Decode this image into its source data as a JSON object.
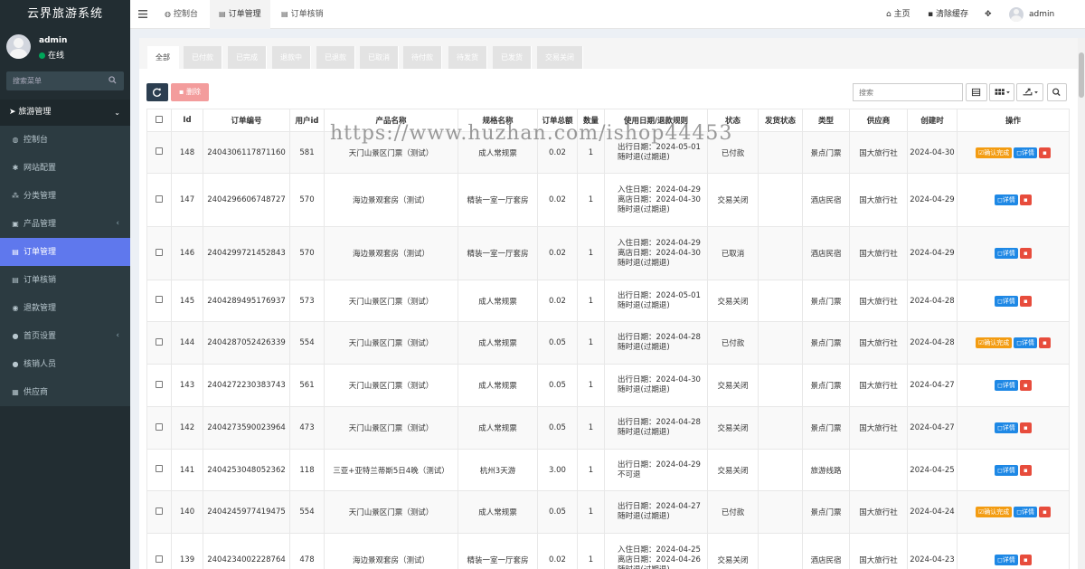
{
  "app": {
    "title": "云界旅游系统"
  },
  "user": {
    "name": "admin",
    "status": "在线"
  },
  "sidebar": {
    "search_placeholder": "搜索菜单",
    "section": "旅游管理",
    "items": [
      {
        "label": "控制台",
        "icon": "dashboard-icon",
        "glyph": "◍",
        "arrow": ""
      },
      {
        "label": "网站配置",
        "icon": "gear-icon",
        "glyph": "✱",
        "arrow": ""
      },
      {
        "label": "分类管理",
        "icon": "sitemap-icon",
        "glyph": "⁂",
        "arrow": ""
      },
      {
        "label": "产品管理",
        "icon": "box-icon",
        "glyph": "▣",
        "arrow": "‹"
      },
      {
        "label": "订单管理",
        "icon": "file-icon",
        "glyph": "▤",
        "arrow": "",
        "active": true
      },
      {
        "label": "订单核销",
        "icon": "file-check-icon",
        "glyph": "▤",
        "arrow": ""
      },
      {
        "label": "退款管理",
        "icon": "eye-icon",
        "glyph": "◉",
        "arrow": ""
      },
      {
        "label": "首页设置",
        "icon": "users-icon",
        "glyph": "●",
        "arrow": "‹"
      },
      {
        "label": "核销人员",
        "icon": "user-icon",
        "glyph": "●",
        "arrow": ""
      },
      {
        "label": "供应商",
        "icon": "id-card-icon",
        "glyph": "▦",
        "arrow": ""
      }
    ]
  },
  "topbar": {
    "tabs": [
      {
        "label": "控制台",
        "glyph": "◍"
      },
      {
        "label": "订单管理",
        "glyph": "▤"
      },
      {
        "label": "订单核销",
        "glyph": "▤"
      }
    ],
    "home_label": "主页",
    "clear_cache_label": "清除缓存",
    "user_label": "admin"
  },
  "filters": [
    "全部",
    "已付款",
    "已完成",
    "退款中",
    "已退款",
    "已取消",
    "待付款",
    "待发货",
    "已发货",
    "交易关闭"
  ],
  "toolbar": {
    "delete_label": "删除",
    "search_placeholder": "搜索"
  },
  "table": {
    "headers": [
      "Id",
      "订单编号",
      "用户id",
      "产品名称",
      "规格名称",
      "订单总额",
      "数量",
      "使用日期/退款规则",
      "状态",
      "发货状态",
      "类型",
      "供应商",
      "创建时",
      "操作"
    ],
    "confirm_label": "确认完成",
    "detail_label": "详情",
    "rows": [
      {
        "id": "148",
        "order_no": "2404306117871160",
        "user_id": "581",
        "product": "天门山景区门票（测试）",
        "spec": "成人常规票",
        "total": "0.02",
        "qty": "1",
        "rule": [
          "出行日期：2024-05-01",
          "随时退(过期退)"
        ],
        "status": "已付款",
        "ship": "",
        "type": "景点门票",
        "supplier": "国大旅行社",
        "created": "2024-04-30",
        "confirm": true
      },
      {
        "id": "147",
        "order_no": "2404296606748727",
        "user_id": "570",
        "product": "海边景观套房（测试）",
        "spec": "精装一室一厅套房",
        "total": "0.02",
        "qty": "1",
        "rule": [
          "入住日期：2024-04-29",
          "离店日期：2024-04-30",
          "随时退(过期退)"
        ],
        "status": "交易关闭",
        "ship": "",
        "type": "酒店民宿",
        "supplier": "国大旅行社",
        "created": "2024-04-29",
        "confirm": false
      },
      {
        "id": "146",
        "order_no": "2404299721452843",
        "user_id": "570",
        "product": "海边景观套房（测试）",
        "spec": "精装一室一厅套房",
        "total": "0.02",
        "qty": "1",
        "rule": [
          "入住日期：2024-04-29",
          "离店日期：2024-04-30",
          "随时退(过期退)"
        ],
        "status": "已取消",
        "ship": "",
        "type": "酒店民宿",
        "supplier": "国大旅行社",
        "created": "2024-04-29",
        "confirm": false
      },
      {
        "id": "145",
        "order_no": "2404289495176937",
        "user_id": "573",
        "product": "天门山景区门票（测试）",
        "spec": "成人常规票",
        "total": "0.02",
        "qty": "1",
        "rule": [
          "出行日期：2024-05-01",
          "随时退(过期退)"
        ],
        "status": "交易关闭",
        "ship": "",
        "type": "景点门票",
        "supplier": "国大旅行社",
        "created": "2024-04-28",
        "confirm": false
      },
      {
        "id": "144",
        "order_no": "2404287052426339",
        "user_id": "554",
        "product": "天门山景区门票（测试）",
        "spec": "成人常规票",
        "total": "0.05",
        "qty": "1",
        "rule": [
          "出行日期：2024-04-28",
          "随时退(过期退)"
        ],
        "status": "已付款",
        "ship": "",
        "type": "景点门票",
        "supplier": "国大旅行社",
        "created": "2024-04-28",
        "confirm": true
      },
      {
        "id": "143",
        "order_no": "2404272230383743",
        "user_id": "561",
        "product": "天门山景区门票（测试）",
        "spec": "成人常规票",
        "total": "0.05",
        "qty": "1",
        "rule": [
          "出行日期：2024-04-30",
          "随时退(过期退)"
        ],
        "status": "交易关闭",
        "ship": "",
        "type": "景点门票",
        "supplier": "国大旅行社",
        "created": "2024-04-27",
        "confirm": false
      },
      {
        "id": "142",
        "order_no": "2404273590023964",
        "user_id": "473",
        "product": "天门山景区门票（测试）",
        "spec": "成人常规票",
        "total": "0.05",
        "qty": "1",
        "rule": [
          "出行日期：2024-04-28",
          "随时退(过期退)"
        ],
        "status": "交易关闭",
        "ship": "",
        "type": "景点门票",
        "supplier": "国大旅行社",
        "created": "2024-04-27",
        "confirm": false
      },
      {
        "id": "141",
        "order_no": "2404253048052362",
        "user_id": "118",
        "product": "三亚+亚特兰蒂斯5日4晚（测试）",
        "spec": "杭州3天游",
        "total": "3.00",
        "qty": "1",
        "rule": [
          "出行日期：2024-04-29",
          "不可退"
        ],
        "status": "交易关闭",
        "ship": "",
        "type": "旅游线路",
        "supplier": "",
        "created": "2024-04-25",
        "confirm": false
      },
      {
        "id": "140",
        "order_no": "2404245977419475",
        "user_id": "554",
        "product": "天门山景区门票（测试）",
        "spec": "成人常规票",
        "total": "0.05",
        "qty": "1",
        "rule": [
          "出行日期：2024-04-27",
          "随时退(过期退)"
        ],
        "status": "已付款",
        "ship": "",
        "type": "景点门票",
        "supplier": "国大旅行社",
        "created": "2024-04-24",
        "confirm": true
      },
      {
        "id": "139",
        "order_no": "2404234002228764",
        "user_id": "478",
        "product": "海边景观套房（测试）",
        "spec": "精装一室一厅套房",
        "total": "0.02",
        "qty": "1",
        "rule": [
          "入住日期：2024-04-25",
          "离店日期：2024-04-26",
          "随时退(过期退)"
        ],
        "status": "交易关闭",
        "ship": "",
        "type": "酒店民宿",
        "supplier": "国大旅行社",
        "created": "2024-04-23",
        "confirm": false
      }
    ]
  },
  "watermark": "https://www.huzhan.com/ishop44453"
}
